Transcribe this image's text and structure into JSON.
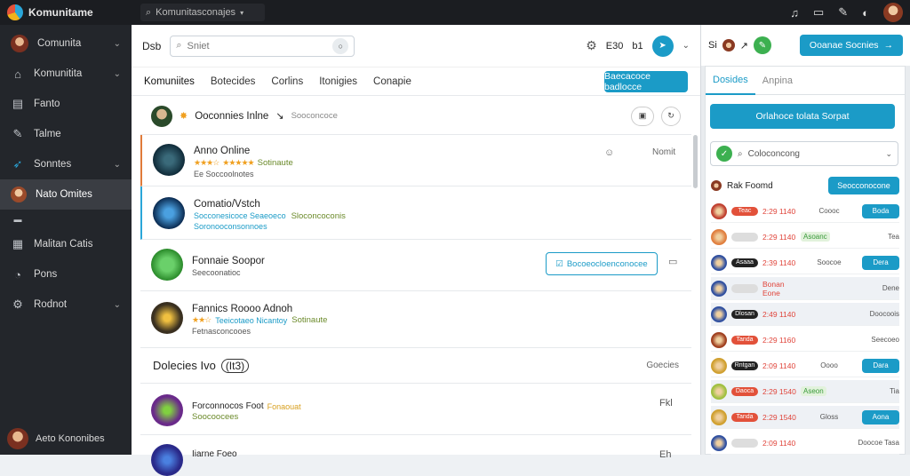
{
  "topbar": {
    "app_title": "Komunitame",
    "search_placeholder": "Komunitasconajes"
  },
  "sidebar": {
    "items": [
      {
        "label": "Comunita",
        "icon": "user-avatar",
        "chevron": true
      },
      {
        "label": "Komunitita",
        "icon": "home-icon",
        "chevron": true
      },
      {
        "label": "Fanto",
        "icon": "document-icon",
        "chevron": false
      },
      {
        "label": "Talme",
        "icon": "pen-icon",
        "chevron": false
      },
      {
        "label": "Sonntes",
        "icon": "rocket-icon",
        "chevron": true
      },
      {
        "label": "Nato Omites",
        "icon": "user-avatar",
        "chevron": false,
        "active": true
      },
      {
        "label": "",
        "icon": "dots-icon",
        "chevron": false
      },
      {
        "label": "Malitan Catis",
        "icon": "grid-icon",
        "chevron": false
      },
      {
        "label": "Pons",
        "icon": "bell-icon",
        "chevron": false
      },
      {
        "label": "Rodnot",
        "icon": "gear-icon",
        "chevron": true
      }
    ],
    "footer_user": "Aeto Kononibes"
  },
  "main": {
    "header_label": "Dsb",
    "search_placeholder": "Sniet",
    "header_status": "E30",
    "header_status2": "b1",
    "tabs": [
      "Komuniites",
      "Botecides",
      "Corlins",
      "Itonigies",
      "Conapie"
    ],
    "action_button": "Baecacoce badlocce",
    "list_title": "Ooconnies Inlne",
    "list_meta": "Sooconcoce",
    "cards": [
      {
        "title": "Anno Online",
        "stars": "★★★☆",
        "stars2": "★★★★★",
        "sub": "Sotinaute",
        "meta": "Ee Soccoolnotes",
        "side": "Nomit"
      },
      {
        "title": "Comatio/Vstch",
        "sub": "Socconesicoce Seaeoeco",
        "sub2": "Sloconcoconis",
        "meta": "Soronooconsonnoes"
      },
      {
        "title": "Fonnaie Soopor",
        "meta": "Seecoonatioc",
        "button": "Bocoeocloenconocee"
      },
      {
        "title": "Fannics Roooo Adnoh",
        "stars": "★★☆",
        "sub": "Teeicotaeo Nicantoy",
        "sub2": "Sotinaute",
        "meta": "Fetnasconcooes"
      }
    ],
    "section_title": "Dolecies Ivo",
    "section_count": "(It3)",
    "section_right": "Goecies",
    "cards2": [
      {
        "title": "Forconnocos Foot",
        "tag": "Fonaouat",
        "meta": "Soocoocees",
        "side": "Fkl"
      },
      {
        "title": "Iiarne Foeo",
        "meta": "",
        "side": "Eh"
      }
    ]
  },
  "right": {
    "header_label": "Si",
    "header_button": "Ooanae Socnies",
    "tabs": [
      "Dosides",
      "Anpina"
    ],
    "primary_button": "Orlahoce tolata Sorpat",
    "search_placeholder": "Coloconcong",
    "list_title": "Rak Foomd",
    "list_button": "Seocconocone",
    "rows": [
      {
        "badge": "Teac",
        "score": "2:29 1140",
        "label": "Coooc",
        "btn": "Boda"
      },
      {
        "badge": "",
        "score": "2:29 1140",
        "pill": "Asoanc",
        "label": "Tea"
      },
      {
        "badge": "Asaaa",
        "score": "2:39 1140",
        "label": "Soocoe",
        "btn": "Dera"
      },
      {
        "badge": "",
        "score": "Bonan Eone",
        "label": "Dene",
        "alt": true
      },
      {
        "badge": "Dlosan",
        "score": "2:49 1140",
        "label": "Doocoois",
        "alt": true
      },
      {
        "badge": "Tanda",
        "score": "2:29 1160",
        "label": "Seecoeo"
      },
      {
        "badge": "Rntgan",
        "score": "2:09 1140",
        "label": "Oooo",
        "btn": "Dara"
      },
      {
        "badge": "Daoca",
        "score": "2:29 1540",
        "pill": "Aseon",
        "label": "Tia",
        "alt": true
      },
      {
        "badge": "Tanda",
        "score": "2:29 1540",
        "label": "Gloss",
        "btn": "Aona",
        "alt": true
      },
      {
        "badge": "",
        "score": "2:09 1140",
        "label": "Doocoe Tasa"
      }
    ]
  },
  "colors": {
    "accent": "#1b9bc7",
    "sidebar": "#23262b",
    "topbar": "#1b1d21"
  }
}
